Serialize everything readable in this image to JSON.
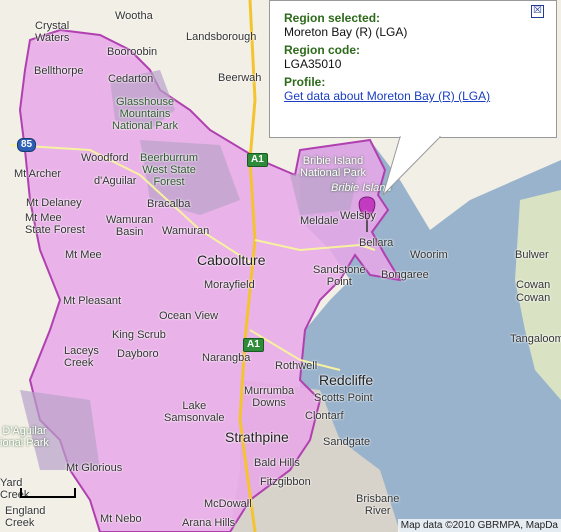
{
  "colors": {
    "land": "#f2efe6",
    "sea": "#99b3cc",
    "region": "#e8a7e8",
    "region_border": "#b040b0",
    "park": "#b9c9a3",
    "urban": "#d7d2ca",
    "marker": "#c23ac0",
    "arrow": "#8b0000"
  },
  "popup": {
    "region_selected_label": "Region selected:",
    "region_selected_value": "Moreton Bay (R) (LGA)",
    "region_code_label": "Region code:",
    "region_code_value": "LGA35010",
    "profile_label": "Profile:",
    "profile_link": "Get data about Moreton Bay (R) (LGA)",
    "close_glyph": "☒"
  },
  "attribution": "Map data ©2010 GBRMPA, MapDa",
  "road_shields": {
    "m85": "85",
    "a1_north": "A1",
    "a1_south": "A1"
  },
  "places": {
    "wootha": "Wootha",
    "crystal_waters": "Crystal\nWaters",
    "landsborough": "Landsborough",
    "booroobin": "Booroobin",
    "bellthorpe": "Bellthorpe",
    "cedarton": "Cedarton",
    "beerwah": "Beerwah",
    "glasshouse": "Glasshouse\nMountains\nNational Park",
    "woodford": "Woodford",
    "daguilar": "d'Aguilar",
    "beerburrum": "Beerburrum\nWest State\nForest",
    "bribie_np": "Bribie Island\nNational Park",
    "bribie_island": "Bribie Island",
    "mt_archer": "Mt Archer",
    "mt_delaney": "Mt Delaney",
    "bracalba": "Bracalba",
    "meldale": "Meldale",
    "welsby": "Welsby",
    "mt_mee_sf": "Mt Mee\nState Forest",
    "wamuran_basin": "Wamuran\nBasin",
    "wamuran": "Wamuran",
    "bellara": "Bellara",
    "woorim": "Woorim",
    "bulwer": "Bulwer",
    "mt_mee": "Mt Mee",
    "caboolture": "Caboolture",
    "sandstone_point": "Sandstone\nPoint",
    "bongaree": "Bongaree",
    "morayfield": "Morayfield",
    "cowan_cowan1": "Cowan",
    "cowan_cowan2": "Cowan",
    "mt_pleasant": "Mt Pleasant",
    "ocean_view": "Ocean View",
    "king_scrub": "King Scrub",
    "tangalooma": "Tangalooma",
    "laceys_creek": "Laceys\nCreek",
    "dayboro": "Dayboro",
    "narangba": "Narangba",
    "rothwell": "Rothwell",
    "redcliffe": "Redcliffe",
    "murrumba_downs": "Murrumba\nDowns",
    "scotts_point": "Scotts Point",
    "lake_samsonvale": "Lake\nSamsonvale",
    "clontarf": "Clontarf",
    "daguilar_np": "D'Aguilar\nional Park",
    "strathpine": "Strathpine",
    "sandgate": "Sandgate",
    "bald_hills": "Bald Hills",
    "mt_glorious": "Mt Glorious",
    "fitzgibbon": "Fitzgibbon",
    "yard_creek": "Yard\nCreek",
    "mcdowall": "McDowall",
    "brisbane_river": "Brisbane\nRiver",
    "england_creek": "England\nCreek",
    "mt_nebo": "Mt Nebo",
    "arana_hills": "Arana Hills"
  }
}
